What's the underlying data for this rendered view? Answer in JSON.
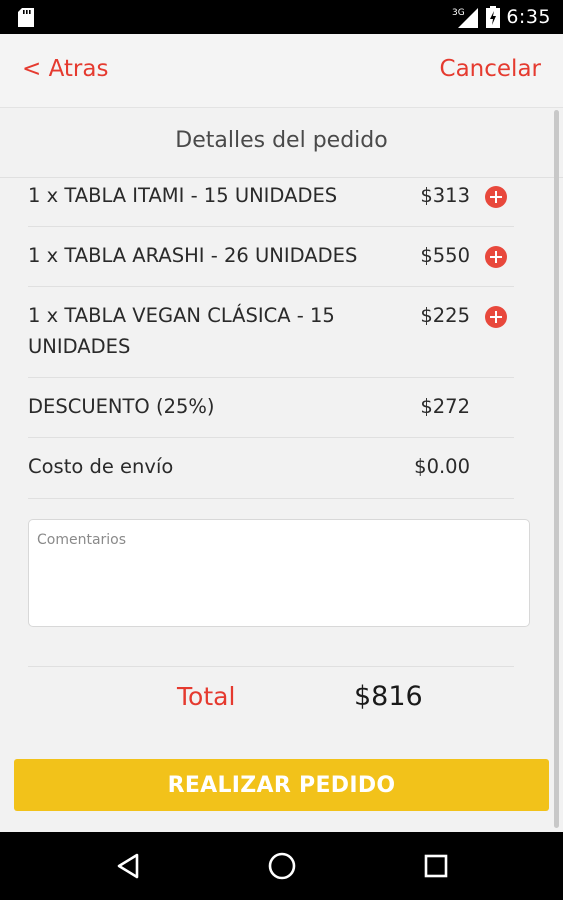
{
  "status_bar": {
    "time": "6:35",
    "network": "3G",
    "icons": [
      "sd-card-icon",
      "signal-icon",
      "battery-icon"
    ]
  },
  "header": {
    "back_label": "< Atras",
    "cancel_label": "Cancelar"
  },
  "section_title": "Detalles del pedido",
  "items": [
    {
      "name": "1 x TABLA ITAMI - 15 UNIDADES",
      "price": "$313",
      "action_icon": "add-circle-icon"
    },
    {
      "name": "1 x TABLA ARASHI - 26 UNIDADES",
      "price": "$550",
      "action_icon": "add-circle-icon"
    },
    {
      "name": "1 x TABLA VEGAN CLÁSICA - 15 UNIDADES",
      "price": "$225",
      "action_icon": "add-circle-icon"
    }
  ],
  "discount": {
    "label": "DESCUENTO (25%)",
    "value": "$272"
  },
  "shipping": {
    "label": "Costo de envío",
    "value": "$0.00"
  },
  "comments": {
    "placeholder": "Comentarios",
    "value": ""
  },
  "total": {
    "label": "Total",
    "value": "$816"
  },
  "order_button": "REALIZAR PEDIDO",
  "nav_icons": [
    "back-triangle-icon",
    "home-circle-icon",
    "recents-square-icon"
  ],
  "colors": {
    "accent": "#e53a2f",
    "button": "#f2c21a",
    "background": "#f2f2f2"
  }
}
